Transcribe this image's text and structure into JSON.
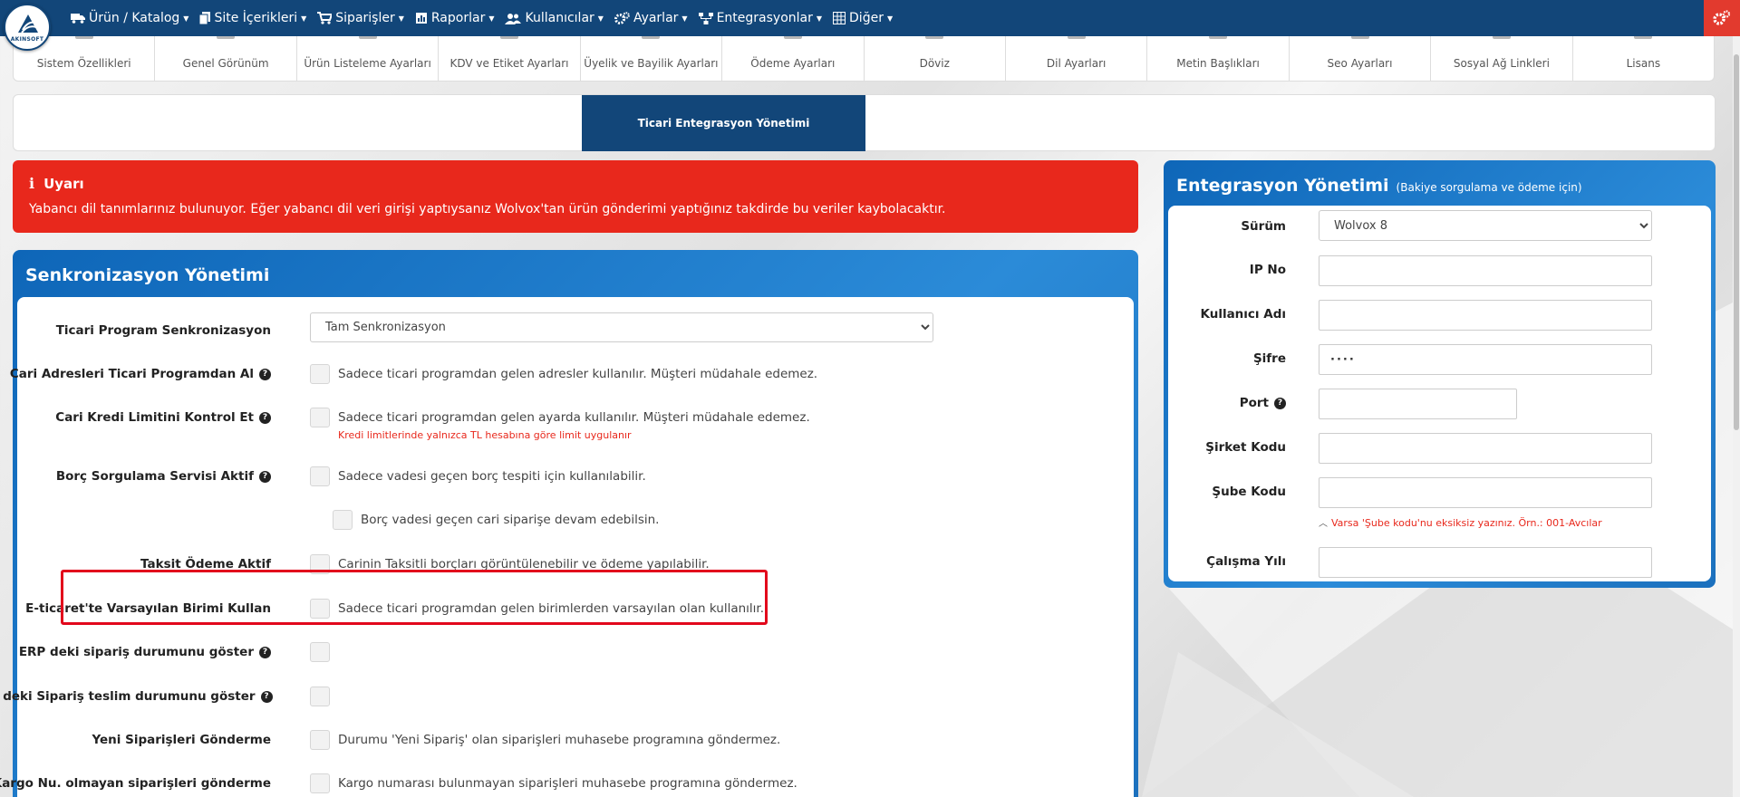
{
  "logo": {
    "text": "AKINSOFT"
  },
  "nav": {
    "items": [
      {
        "label": "Ürün / Katalog",
        "icon": "truck-icon"
      },
      {
        "label": "Site İçerikleri",
        "icon": "files-icon"
      },
      {
        "label": "Siparişler",
        "icon": "cart-icon"
      },
      {
        "label": "Raporlar",
        "icon": "report-icon"
      },
      {
        "label": "Kullanıcılar",
        "icon": "users-icon"
      },
      {
        "label": "Ayarlar",
        "icon": "cogs-icon"
      },
      {
        "label": "Entegrasyonlar",
        "icon": "sitemap-icon"
      },
      {
        "label": "Diğer",
        "icon": "grid-icon"
      }
    ]
  },
  "settings_tabs": [
    "Sistem Özellikleri",
    "Genel Görünüm",
    "Ürün Listeleme Ayarları",
    "KDV ve Etiket Ayarları",
    "Üyelik ve Bayilik Ayarları",
    "Ödeme Ayarları",
    "Döviz",
    "Dil Ayarları",
    "Metin Başlıkları",
    "Seo Ayarları",
    "Sosyal Ağ Linkleri",
    "Lisans"
  ],
  "sub_tab": {
    "label": "Ticari Entegrasyon Yönetimi"
  },
  "alert": {
    "title": "Uyarı",
    "message": "Yabancı dil tanımlarınız bulunuyor. Eğer yabancı dil veri girişi yaptıysanız Wolvox'tan ürün gönderimi yaptığınız takdirde bu veriler kaybolacaktır."
  },
  "sync": {
    "title": "Senkronizasyon Yönetimi",
    "program_sync": {
      "label": "Ticari Program Senkronizasyon",
      "value": "Tam Senkronizasyon"
    },
    "rows": [
      {
        "label": "Cari Adresleri Ticari Programdan Al",
        "desc": "Sadece ticari programdan gelen adresler kullanılır. Müşteri müdahale edemez."
      },
      {
        "label": "Cari Kredi Limitini Kontrol Et",
        "desc": "Sadece ticari programdan gelen ayarda kullanılır. Müşteri müdahale edemez.",
        "note": "Kredi limitlerinde yalnızca TL hesabına göre limit uygulanır"
      },
      {
        "label": "Borç Sorgulama Servisi Aktif",
        "desc": "Sadece vadesi geçen borç tespiti için kullanılabilir."
      },
      {
        "label": "",
        "desc": "Borç vadesi geçen cari siparişe devam edebilsin."
      },
      {
        "label": "Taksit Ödeme Aktif",
        "desc": "Carinin Taksitli borçları görüntülenebilir ve ödeme yapılabilir."
      },
      {
        "label": "E-ticaret'te Varsayılan Birimi Kullan",
        "desc": "Sadece ticari programdan gelen birimlerden varsayılan olan kullanılır."
      },
      {
        "label": "ERP deki sipariş durumunu göster",
        "desc": ""
      },
      {
        "label": "ERP deki Sipariş teslim durumunu göster",
        "desc": ""
      },
      {
        "label": "Yeni Siparişleri Gönderme",
        "desc": "Durumu 'Yeni Sipariş' olan siparişleri muhasebe programına göndermez."
      },
      {
        "label": "Kargo Nu. olmayan siparişleri gönderme",
        "desc": "Kargo numarası bulunmayan siparişleri muhasebe programına göndermez."
      }
    ]
  },
  "integration": {
    "title": "Entegrasyon Yönetimi",
    "subtitle": "(Bakiye sorgulama ve ödeme için)",
    "version": {
      "label": "Sürüm",
      "value": "Wolvox 8"
    },
    "ip": {
      "label": "IP No",
      "value": ""
    },
    "username": {
      "label": "Kullanıcı Adı",
      "value": ""
    },
    "password": {
      "label": "Şifre",
      "value": "····"
    },
    "port": {
      "label": "Port",
      "value": ""
    },
    "company_code": {
      "label": "Şirket Kodu",
      "value": ""
    },
    "branch_code": {
      "label": "Şube Kodu",
      "value": "",
      "hint": "Varsa 'Şube kodu'nu eksiksiz yazınız. Örn.: 001-Avcılar"
    },
    "year": {
      "label": "Çalışma Yılı",
      "value": ""
    }
  }
}
